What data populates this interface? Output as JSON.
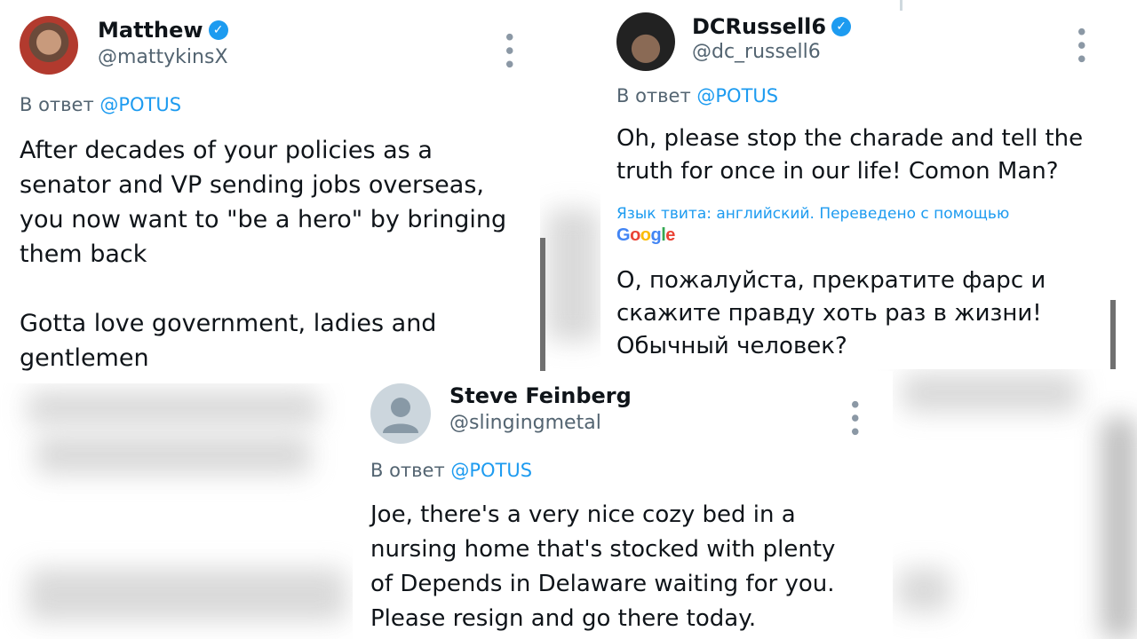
{
  "tweets": [
    {
      "name": "Matthew",
      "handle": "@mattykinsX",
      "reply_prefix": "В ответ",
      "reply_to": "@POTUS",
      "text": "After decades of your policies as a\nsenator and VP sending jobs overseas,\nyou now want to \"be a hero\" by bringing\nthem back\n\nGotta love government, ladies and\ngentlemen"
    },
    {
      "name": "DCRussell6",
      "handle": "@dc_russell6",
      "reply_prefix": "В ответ",
      "reply_to": "@POTUS",
      "text": "Oh, please stop the charade and tell the\ntruth for once in our life! Comon Man?",
      "translation_note": "Язык твита: английский. Переведено с помощью",
      "translation_provider": "Google",
      "translated_text": "О, пожалуйста, прекратите фарс и\nскажите правду хоть раз в жизни!\nОбычный человек?"
    },
    {
      "name": "Steve Feinberg",
      "handle": "@slingingmetal",
      "reply_prefix": "В ответ",
      "reply_to": "@POTUS",
      "text": "Joe, there's a very nice cozy bed in a\nnursing home that's stocked with plenty\nof Depends in Delaware waiting for you.\nPlease resign and  go there today."
    }
  ],
  "icons": {
    "verified": "verified-badge-icon",
    "more": "more-options-icon"
  },
  "colors": {
    "accent": "#1d9bf0",
    "secondary_text": "#536471",
    "text": "#0f1419"
  }
}
